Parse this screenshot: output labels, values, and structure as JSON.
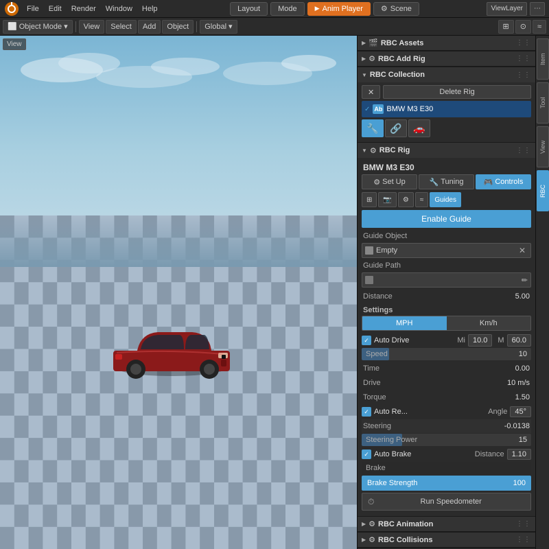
{
  "topMenu": {
    "items": [
      "File",
      "Edit",
      "Render",
      "Window",
      "Help"
    ],
    "logoAlt": "Blender",
    "tabs": [
      {
        "label": "Layout",
        "active": false
      },
      {
        "label": "Mode",
        "active": false
      },
      {
        "label": "Anim Player",
        "active": true,
        "color": "orange"
      },
      {
        "label": "⚙ Scene",
        "active": false
      }
    ],
    "rightTabs": [
      "ViewLayer"
    ]
  },
  "toolbar": {
    "objectMode": "Object Mode",
    "view": "View",
    "select": "Select",
    "add": "Add",
    "object": "Object",
    "global": "Global",
    "icons": [
      "⊞",
      "↔",
      "≈",
      "~"
    ]
  },
  "rightVtabs": [
    "View",
    "Tool",
    "Item",
    "RBC"
  ],
  "panels": {
    "rbcAssets": {
      "title": "RBC Assets",
      "collapsed": true
    },
    "rbcAddRig": {
      "title": "RBC Add Rig",
      "collapsed": true
    },
    "rbcCollection": {
      "title": "RBC Collection",
      "collapsed": false,
      "deleteRigLabel": "Delete Rig",
      "carName": "BMW M3 E30",
      "icons": [
        "🔧",
        "🔗",
        "🚗"
      ]
    },
    "rbcRig": {
      "title": "RBC Rig",
      "rigIcon": "⚙",
      "carName": "BMW M3 E30",
      "tabs": [
        {
          "label": "Set Up",
          "icon": "⚙",
          "active": false
        },
        {
          "label": "Tuning",
          "icon": "🔧",
          "active": false
        },
        {
          "label": "Controls",
          "icon": "🎮",
          "active": true
        }
      ],
      "subtabs": [
        {
          "label": "⊞",
          "active": false
        },
        {
          "label": "📷",
          "active": false
        },
        {
          "label": "⚙",
          "active": false
        },
        {
          "label": "≈",
          "active": false
        },
        {
          "label": "Guides",
          "active": true
        }
      ],
      "enableGuide": "Enable Guide",
      "guideObject": {
        "label": "Guide Object",
        "value": "Empty",
        "hasX": true
      },
      "guidePath": {
        "label": "Guide Path"
      },
      "distance": {
        "label": "Distance",
        "value": "5.00"
      },
      "settings": "Settings",
      "speedToggle": [
        "MPH",
        "Km/h"
      ],
      "activeSpeedToggle": "MPH",
      "autoDrive": {
        "label": "Auto Drive",
        "miLabel": "Mi",
        "miValue": "10.0",
        "mLabel": "M",
        "mValue": "60.0"
      },
      "speed": {
        "label": "Speed",
        "value": "10"
      },
      "time": {
        "label": "Time",
        "value": "0.00"
      },
      "drive": {
        "label": "Drive",
        "value": "10 m/s"
      },
      "torque": {
        "label": "Torque",
        "value": "1.50"
      },
      "autoRe": {
        "label": "Auto Re...",
        "angleLabel": "Angle",
        "angleValue": "45°"
      },
      "steering": {
        "label": "Steering",
        "value": "-0.0138"
      },
      "steeringPower": {
        "label": "Steering Power",
        "value": "15"
      },
      "autoBrake": {
        "label": "Auto Brake",
        "distLabel": "Distance",
        "distValue": "1.10"
      },
      "brake": {
        "label": "Brake"
      },
      "brakeStrength": {
        "label": "Brake Strength",
        "value": "100"
      },
      "runSpeedometer": "Run Speedometer"
    },
    "rbcAnimation": {
      "title": "RBC Animation",
      "collapsed": true
    },
    "rbcCollisions": {
      "title": "RBC Collisions",
      "collapsed": true
    }
  }
}
